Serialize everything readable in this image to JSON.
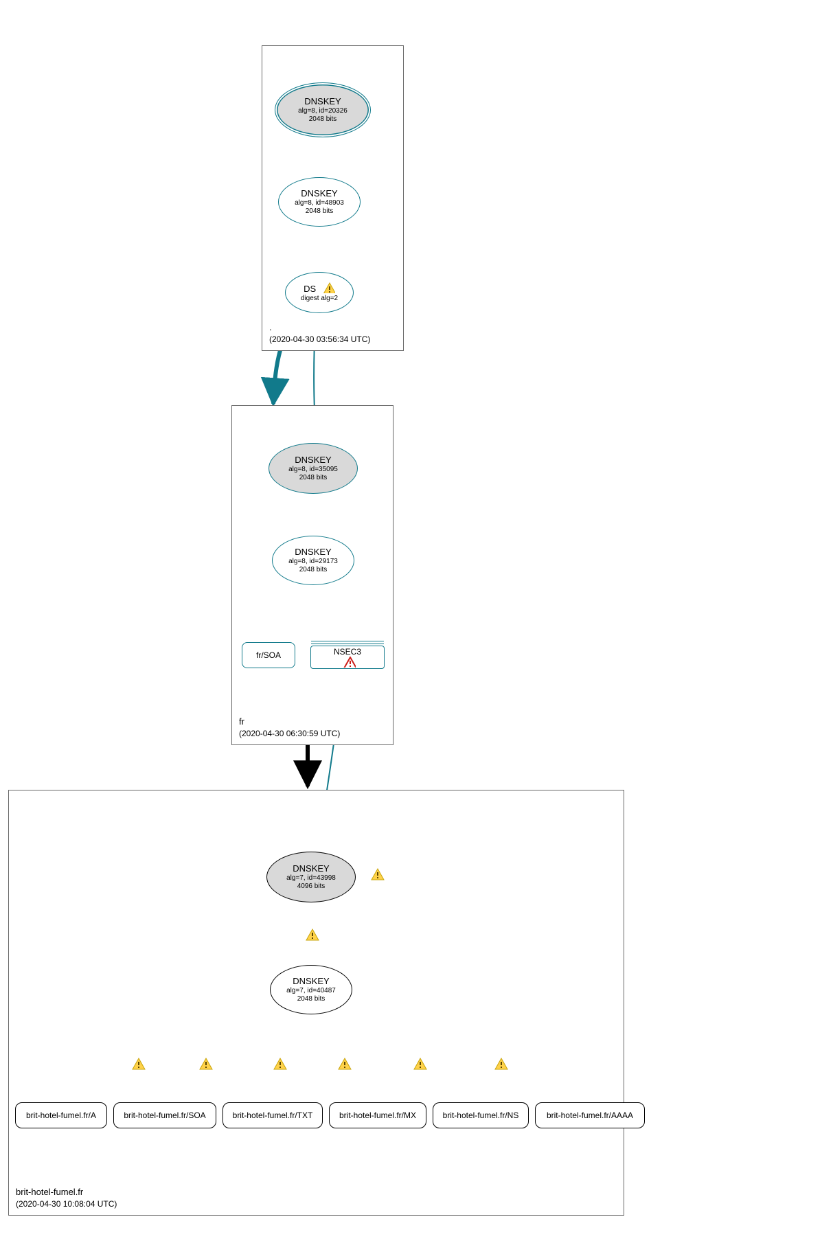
{
  "colors": {
    "teal": "#117a8b",
    "black": "#000000",
    "grey": "#d9d9d9"
  },
  "zones": {
    "root": {
      "name": ".",
      "timestamp": "(2020-04-30 03:56:34 UTC)",
      "nodes": {
        "ksk": {
          "title": "DNSKEY",
          "sub1": "alg=8, id=20326",
          "sub2": "2048 bits"
        },
        "zsk": {
          "title": "DNSKEY",
          "sub1": "alg=8, id=48903",
          "sub2": "2048 bits"
        },
        "ds": {
          "title": "DS",
          "sub1": "digest alg=2"
        }
      }
    },
    "fr": {
      "name": "fr",
      "timestamp": "(2020-04-30 06:30:59 UTC)",
      "nodes": {
        "ksk": {
          "title": "DNSKEY",
          "sub1": "alg=8, id=35095",
          "sub2": "2048 bits"
        },
        "zsk": {
          "title": "DNSKEY",
          "sub1": "alg=8, id=29173",
          "sub2": "2048 bits"
        },
        "soa": {
          "label": "fr/SOA"
        },
        "nsec": {
          "label": "NSEC3"
        }
      }
    },
    "domain": {
      "name": "brit-hotel-fumel.fr",
      "timestamp": "(2020-04-30 10:08:04 UTC)",
      "nodes": {
        "ksk": {
          "title": "DNSKEY",
          "sub1": "alg=7, id=43998",
          "sub2": "4096 bits"
        },
        "zsk": {
          "title": "DNSKEY",
          "sub1": "alg=7, id=40487",
          "sub2": "2048 bits"
        }
      },
      "records": {
        "a": "brit-hotel-fumel.fr/A",
        "soa": "brit-hotel-fumel.fr/SOA",
        "txt": "brit-hotel-fumel.fr/TXT",
        "mx": "brit-hotel-fumel.fr/MX",
        "ns": "brit-hotel-fumel.fr/NS",
        "aaaa": "brit-hotel-fumel.fr/AAAA"
      }
    }
  }
}
